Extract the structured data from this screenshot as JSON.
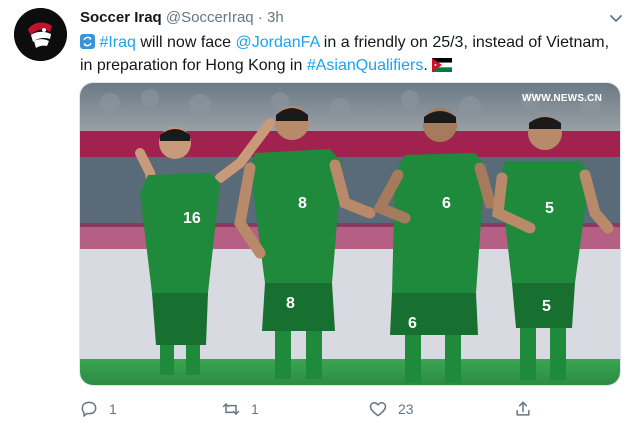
{
  "author": {
    "name": "Soccer Iraq",
    "handle": "@SoccerIraq",
    "separator": "·",
    "time": "3h"
  },
  "tweet": {
    "hashtag_iraq": "#Iraq",
    "text_1": " will now face ",
    "mention": "@JordanFA",
    "text_2": " in a friendly on 25/3, instead of Vietnam, in preparation for Hong Kong in ",
    "hashtag_asian": "#AsianQualifiers",
    "text_3": ". "
  },
  "media": {
    "watermark": "WWW.NEWS.CN",
    "jersey_numbers": [
      "16",
      "8",
      "6",
      "5",
      "8",
      "6",
      "5"
    ]
  },
  "actions": {
    "replies": "1",
    "retweets": "1",
    "likes": "23"
  },
  "icons": {
    "reply": "reply-icon",
    "retweet": "retweet-icon",
    "like": "heart-icon",
    "share": "share-icon",
    "more": "chevron-down-icon"
  },
  "colors": {
    "link": "#1da1f2",
    "muted": "#657786",
    "kit_green": "#1f8a3c",
    "pitch_green": "#2f9d4a"
  }
}
